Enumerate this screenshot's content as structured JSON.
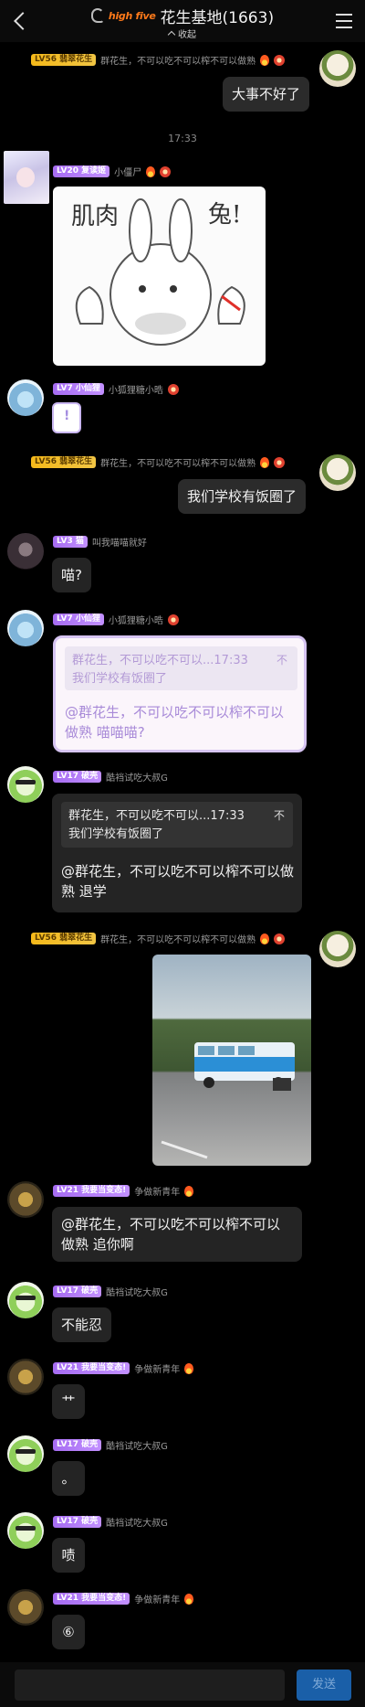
{
  "header": {
    "brand": "high five",
    "title": "花生基地(1663)",
    "collapse_label": "收起"
  },
  "messages": [
    {
      "badge": "LV56 翡翠花生",
      "name": "群花生，不可以吃不可以榨不可以做熟",
      "text": "大事不好了"
    },
    {
      "time": "17:33"
    },
    {
      "badge": "LV20 复读姬",
      "name": "小僵尸",
      "sticker_text_left": "肌肉",
      "sticker_text_right": "兔!"
    },
    {
      "badge": "LV7 小仙狸",
      "name": "小狐狸糖小晧"
    },
    {
      "badge": "LV56 翡翠花生",
      "name": "群花生，不可以吃不可以榨不可以做熟",
      "text": "我们学校有饭圈了"
    },
    {
      "badge": "LV3 猫",
      "name": "叫我喵喵就好",
      "text": "喵?"
    },
    {
      "badge": "LV7 小仙狸",
      "name": "小狐狸糖小晧",
      "quote_header": "群花生，不可以吃不可以...17:33",
      "quote_close": "不",
      "quote_text": "我们学校有饭圈了",
      "text": "@群花生，不可以吃不可以榨不可以做熟 喵喵喵?"
    },
    {
      "badge": "LV17 破壳",
      "name": "酷裆试吃大叔G",
      "quote_header": "群花生，不可以吃不可以...17:33",
      "quote_close": "不",
      "quote_text": "我们学校有饭圈了",
      "text": "@群花生，不可以吃不可以榨不可以做熟 退学"
    },
    {
      "badge": "LV56 翡翠花生",
      "name": "群花生，不可以吃不可以榨不可以做熟"
    },
    {
      "badge": "LV21 我要当变态!",
      "name": "争做新青年",
      "text": "@群花生，不可以吃不可以榨不可以做熟 追你啊"
    },
    {
      "badge": "LV17 破壳",
      "name": "酷裆试吃大叔G",
      "text": "不能忍"
    },
    {
      "badge": "LV21 我要当变态!",
      "name": "争做新青年",
      "text": "艹"
    },
    {
      "badge": "LV17 破壳",
      "name": "酷裆试吃大叔G",
      "text": "。"
    },
    {
      "badge": "LV17 破壳",
      "name": "酷裆试吃大叔G",
      "text": "啧"
    },
    {
      "badge": "LV21 我要当变态!",
      "name": "争做新青年",
      "text": "⑥"
    }
  ],
  "input": {
    "placeholder": "",
    "send_label": "发送"
  }
}
